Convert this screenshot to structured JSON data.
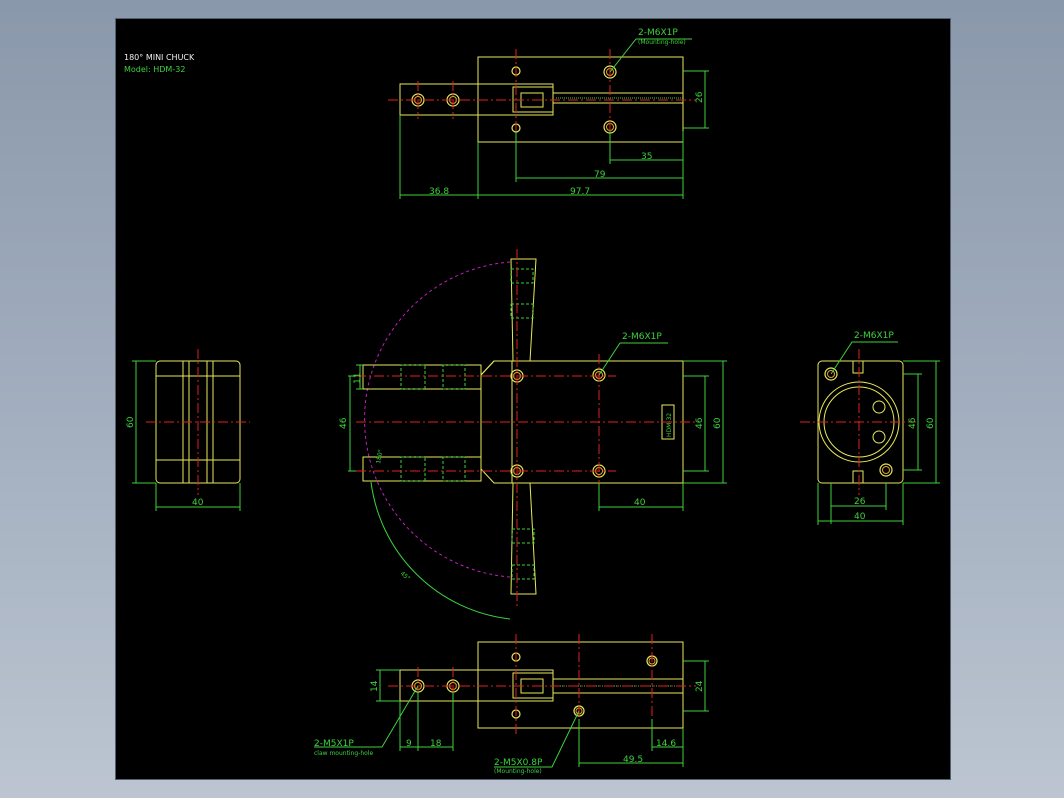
{
  "title": {
    "line1": "180° MINI CHUCK",
    "line2": "Model: HDM-32"
  },
  "top_view": {
    "callout": "2-M6X1P",
    "callout_sub": "(Mounting-hole)",
    "dims": {
      "height": "26",
      "d35": "35",
      "d79": "79",
      "d36_8": "36.8",
      "d97_7": "97.7"
    }
  },
  "front_view": {
    "callout": "2-M6X1P",
    "dims": {
      "d11": "11",
      "d46_left": "46",
      "d46_right": "46",
      "d60": "60",
      "d40": "40"
    },
    "rotation_label": "180°",
    "arc_label": "45°",
    "label_tag": "HDM-32"
  },
  "left_view": {
    "dims": {
      "height": "60",
      "width": "40"
    }
  },
  "right_view": {
    "callout": "2-M6X1P",
    "dims": {
      "d26": "26",
      "d40": "40",
      "d46": "46",
      "d60": "60"
    }
  },
  "bottom_view": {
    "callout_left": "2-M5X1P",
    "callout_left_sub": "claw mounting-hole",
    "callout_right": "2-M5X0.8P",
    "callout_right_sub": "(Mounting-hole)",
    "dims": {
      "d14": "14",
      "d9": "9",
      "d18": "18",
      "d24": "24",
      "d14_6": "14.6",
      "d49_5": "49.5"
    }
  }
}
